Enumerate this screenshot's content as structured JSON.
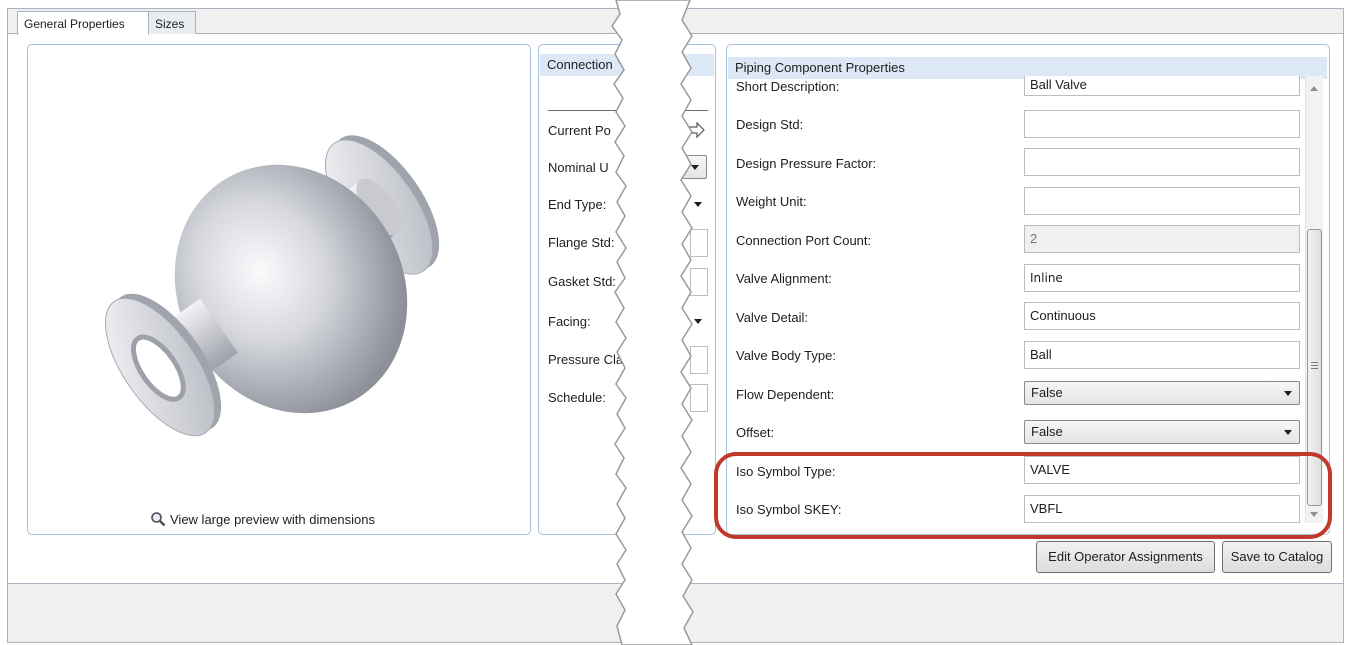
{
  "tabs": [
    {
      "label": "General Properties",
      "active": true
    },
    {
      "label": "Sizes",
      "active": false
    }
  ],
  "preview": {
    "link_icon": "magnifier-icon",
    "link_label": "View large preview with dimensions"
  },
  "connection_panel": {
    "header": "Connection ",
    "rows": [
      {
        "label": "Current Po",
        "control": "arrow-right-icon"
      },
      {
        "label": "Nominal U",
        "control": "dropdown"
      },
      {
        "label": "End Type:",
        "control": "dropdown"
      },
      {
        "label": "Flange Std:",
        "control": "textbox"
      },
      {
        "label": "Gasket Std:",
        "control": "textbox"
      },
      {
        "label": "Facing:",
        "control": "dropdown"
      },
      {
        "label": "Pressure Cla",
        "control": "textbox"
      },
      {
        "label": "Schedule:",
        "control": "textbox"
      }
    ]
  },
  "properties_panel": {
    "header": "Piping Component Properties",
    "rows": [
      {
        "label": "Short Description:",
        "value": "Ball Valve",
        "type": "text"
      },
      {
        "label": "Design Std:",
        "value": "",
        "type": "text"
      },
      {
        "label": "Design Pressure Factor:",
        "value": "",
        "type": "text"
      },
      {
        "label": "Weight Unit:",
        "value": "",
        "type": "text"
      },
      {
        "label": "Connection Port Count:",
        "value": "2",
        "type": "readonly"
      },
      {
        "label": "Valve Alignment:",
        "value": "Inline",
        "type": "text"
      },
      {
        "label": "Valve Detail:",
        "value": "Continuous",
        "type": "text"
      },
      {
        "label": "Valve Body Type:",
        "value": "Ball",
        "type": "text"
      },
      {
        "label": "Flow Dependent:",
        "value": "False",
        "type": "combo"
      },
      {
        "label": "Offset:",
        "value": "False",
        "type": "combo"
      },
      {
        "label": "Iso Symbol Type:",
        "value": "VALVE",
        "type": "text"
      },
      {
        "label": "Iso Symbol SKEY:",
        "value": "VBFL",
        "type": "text"
      }
    ]
  },
  "buttons": {
    "edit_operator": "Edit Operator Assignments",
    "save_catalog": "Save to Catalog"
  },
  "colors": {
    "highlight": "#c0392b",
    "panel_header": "#dce8f5",
    "panel_border": "#a7c0dc"
  }
}
